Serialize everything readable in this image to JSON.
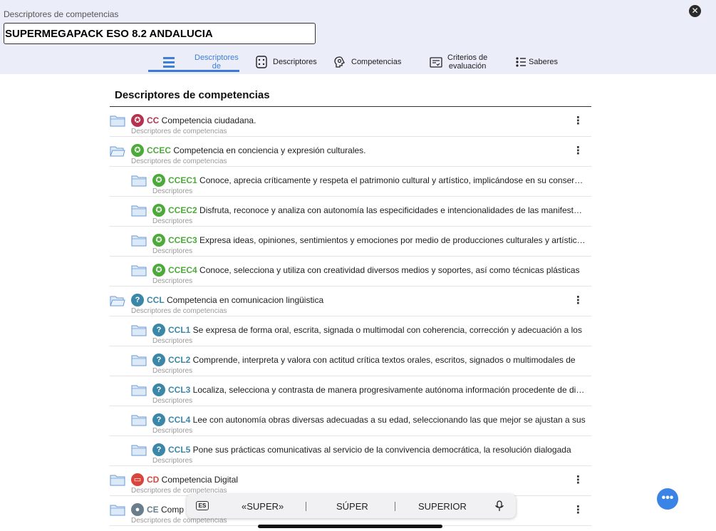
{
  "header": {
    "label": "Descriptores de competencias",
    "title_value": "SUPERMEGAPACK ESO 8.2 ANDALUCIA",
    "close_icon": "close-icon"
  },
  "tabs": [
    {
      "line1": "Descriptores",
      "line2": "de",
      "icon": "descriptores-de-icon",
      "active": true
    },
    {
      "line1": "Descriptores",
      "line2": "",
      "icon": "descriptores-icon",
      "active": false
    },
    {
      "line1": "Competencias",
      "line2": "",
      "icon": "competencias-icon",
      "active": false
    },
    {
      "line1": "Criterios de",
      "line2": "evaluación",
      "icon": "criterios-icon",
      "active": false
    },
    {
      "line1": "Saberes",
      "line2": "",
      "icon": "saberes-icon",
      "active": false
    }
  ],
  "section_title": "Descriptores de competencias",
  "rows": [
    {
      "code": "CC",
      "text": "Competencia ciudadana.",
      "sub": "Descriptores de competencias",
      "color": "#b6324f",
      "badge": "✪",
      "level": 0,
      "more": "⋮"
    },
    {
      "code": "CCEC",
      "text": "Competencia en conciencia y expresión culturales.",
      "sub": "Descriptores de competencias",
      "color": "#4caa3a",
      "badge": "✪",
      "level": 0,
      "more": "⋮"
    },
    {
      "code": "CCEC1",
      "text": "Conoce, aprecia críticamente y respeta el patrimonio cultural y artístico, implicándose en su conservación",
      "sub": "Descriptores",
      "color": "#4caa3a",
      "badge": "✪",
      "level": 1
    },
    {
      "code": "CCEC2",
      "text": "Disfruta, reconoce y analiza con autonomía las especificidades e intencionalidades de las manifestaciones",
      "sub": "Descriptores",
      "color": "#4caa3a",
      "badge": "✪",
      "level": 1
    },
    {
      "code": "CCEC3",
      "text": "Expresa ideas, opiniones, sentimientos y emociones por medio de producciones culturales y artísticas",
      "sub": "Descriptores",
      "color": "#4caa3a",
      "badge": "✪",
      "level": 1
    },
    {
      "code": "CCEC4",
      "text": "Conoce, selecciona y utiliza con creatividad diversos medios y soportes, así como técnicas plásticas",
      "sub": "Descriptores",
      "color": "#4caa3a",
      "badge": "✪",
      "level": 1
    },
    {
      "code": "CCL",
      "text": "Competencia en comunicacion lingüistica",
      "sub": "Descriptores de competencias",
      "color": "#3b87a8",
      "badge": "?",
      "level": 0,
      "more": "⋮"
    },
    {
      "code": "CCL1",
      "text": "Se expresa de forma oral, escrita, signada o multimodal con coherencia, corrección y adecuación a los",
      "sub": "Descriptores",
      "color": "#3b87a8",
      "badge": "?",
      "level": 1
    },
    {
      "code": "CCL2",
      "text": "Comprende, interpreta y valora con actitud crítica textos orales, escritos, signados o multimodales de",
      "sub": "Descriptores",
      "color": "#3b87a8",
      "badge": "?",
      "level": 1
    },
    {
      "code": "CCL3",
      "text": "Localiza, selecciona y contrasta de manera progresivamente autónoma información procedente de diferentes",
      "sub": "Descriptores",
      "color": "#3b87a8",
      "badge": "?",
      "level": 1
    },
    {
      "code": "CCL4",
      "text": "Lee con autonomía obras diversas adecuadas a su edad, seleccionando las que mejor se ajustan a sus",
      "sub": "Descriptores",
      "color": "#3b87a8",
      "badge": "?",
      "level": 1
    },
    {
      "code": "CCL5",
      "text": "Pone sus prácticas comunicativas al servicio de la convivencia democrática, la resolución dialogada",
      "sub": "Descriptores",
      "color": "#3b87a8",
      "badge": "?",
      "level": 1
    },
    {
      "code": "CD",
      "text": "Competencia Digital",
      "sub": "Descriptores de competencias",
      "color": "#d9453c",
      "badge": "▭",
      "level": 0,
      "more": "⋮"
    },
    {
      "code": "CE",
      "text": "Comp",
      "sub": "Descriptores de competencias",
      "color": "#6a7d8a",
      "badge": "●",
      "level": 0,
      "more": "⋮"
    }
  ],
  "keyboard": {
    "lang": "ES",
    "suggestions": [
      "«SUPER»",
      "SÚPER",
      "SUPERIOR"
    ],
    "mic_icon": "microphone-icon"
  },
  "fab_label": "•••"
}
